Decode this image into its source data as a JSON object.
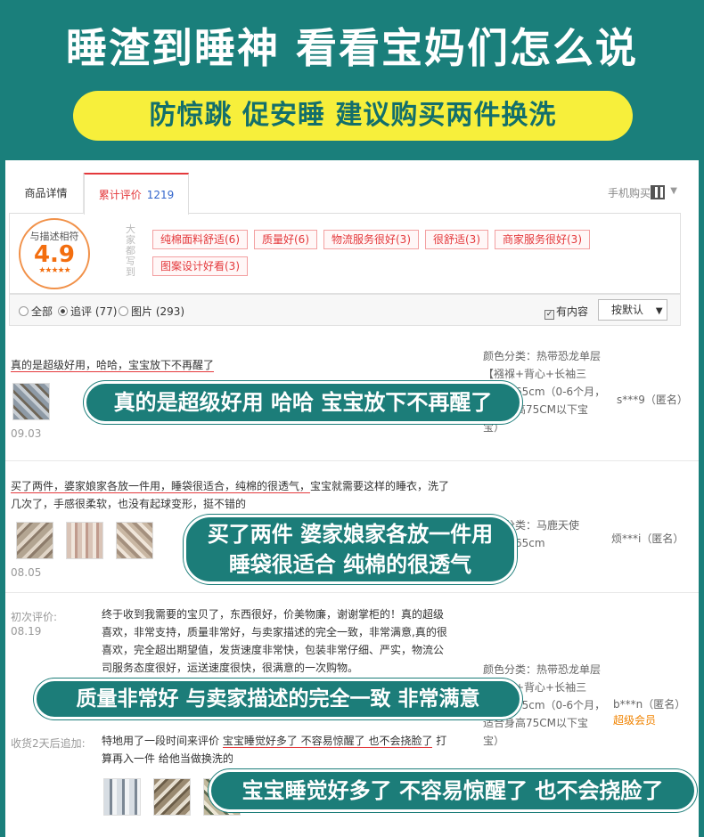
{
  "banner": {
    "headline": "睡渣到睡神  看看宝妈们怎么说",
    "subline": "防惊跳  促安睡  建议购买两件换洗"
  },
  "tabs": {
    "details": "商品详情",
    "reviews": "累计评价",
    "reviews_count": "1219",
    "mobile_buy": "手机购买"
  },
  "rating": {
    "label": "与描述相符",
    "score": "4.9",
    "stars": "★★★★★",
    "side_label": "大家都写到"
  },
  "tags": [
    "纯棉面料舒适(6)",
    "质量好(6)",
    "物流服务很好(3)",
    "很舒适(3)",
    "商家服务很好(3)",
    "图案设计好看(3)"
  ],
  "filter": {
    "all": "全部",
    "followup": "追评 (77)",
    "pictures": "图片 (293)",
    "has_content": "有内容",
    "sort": "按默认"
  },
  "reviews": [
    {
      "text_underlined": "真的是超级好用，哈哈，宝宝放下不再醒了",
      "date": "09.03",
      "meta": [
        "颜色分类：热带恐龙单层",
        "【襁褓+背心+长袖三",
        "长度：65cm（0-6个月，",
        "适合身高75CM以下宝",
        "宝）"
      ],
      "user": "s***9（匿名）",
      "callout": "真的是超级好用  哈哈  宝宝放下不再醒了"
    },
    {
      "text_underlined": "买了两件，婆家娘家各放一件用，睡袋很适合，纯棉的很透气，",
      "text_rest": "宝宝就需要这样的睡衣，洗了",
      "text_line2": "几次了，手感很柔软，也没有起球变形，挺不错的",
      "date": "08.05",
      "meta": [
        "颜色分类：马鹿天使",
        "长度：65cm"
      ],
      "user": "烦***i（匿名）",
      "callout_line1": "买了两件  婆家娘家各放一件用",
      "callout_line2": "睡袋很适合  纯棉的很透气"
    },
    {
      "initial_label": "初次评价:",
      "initial_date": "08.19",
      "initial_text": [
        "终于收到我需要的宝贝了，东西很好，价美物廉，谢谢掌柜的！真的超级",
        "喜欢，非常支持，质量非常好，与卖家描述的完全一致，非常满意,真的很",
        "喜欢，完全超出期望值，发货速度非常快，包装非常仔细、严实，物流公",
        "司服务态度很好，运送速度很快，很满意的一次购物。"
      ],
      "meta": [
        "颜色分类：热带恐龙单层",
        "【襁褓+背心+长袖三",
        "长度：65cm（0-6个月，",
        "适合身高75CM以下宝",
        "宝）"
      ],
      "user": "b***n（匿名）",
      "vip": "超级会员",
      "callout": "质量非常好  与卖家描述的完全一致  非常满意",
      "followup_label": "收货2天后追加:",
      "followup_prefix": "特地用了一段时间来评价 ",
      "followup_underlined": "宝宝睡觉好多了 不容易惊醒了 也不会挠脸了",
      "followup_suffix": " 打",
      "followup_line2": "算再入一件 给他当做换洗的",
      "callout2": "宝宝睡觉好多了  不容易惊醒了  也不会挠脸了"
    }
  ]
}
